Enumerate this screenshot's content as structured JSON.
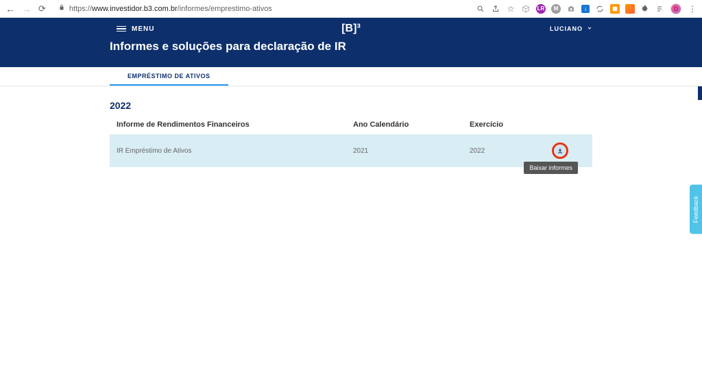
{
  "browser": {
    "url_domain": "www.investidor.b3.com.br",
    "url_path": "/informes/emprestimo-ativos",
    "avatar_letter": "D"
  },
  "header": {
    "menu_label": "MENU",
    "logo_text": "[B]³",
    "user_name": "LUCIANO",
    "page_title": "Informes e soluções para declaração de IR"
  },
  "tabs": {
    "active": "EMPRÉSTIMO DE ATIVOS"
  },
  "table": {
    "year": "2022",
    "headers": {
      "col1": "Informe de Rendimentos Financeiros",
      "col2": "Ano Calendário",
      "col3": "Exercício"
    },
    "rows": [
      {
        "name": "IR Empréstimo de Ativos",
        "calendar_year": "2021",
        "fiscal_year": "2022"
      }
    ],
    "tooltip": "Baixar informes"
  },
  "feedback_label": "Feedback"
}
